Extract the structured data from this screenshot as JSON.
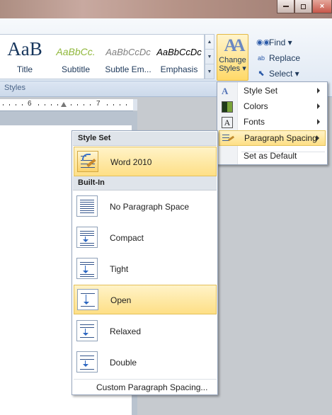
{
  "window": {
    "buttons": [
      "minimize-icon",
      "restore-icon",
      "close-icon"
    ]
  },
  "ribbon": {
    "style_gallery": [
      {
        "sample": "AaB",
        "label": "Title"
      },
      {
        "sample": "AaBbCc.",
        "label": "Subtitle"
      },
      {
        "sample": "AaBbCcDc",
        "label": "Subtle Em..."
      },
      {
        "sample": "AaBbCcDc",
        "label": "Emphasis"
      }
    ],
    "change_styles": {
      "line1": "Change",
      "line2": "Styles ▾"
    },
    "editing": {
      "find": "Find ▾",
      "replace": "Replace",
      "select": "Select ▾"
    },
    "group_label": "Styles"
  },
  "ruler": {
    "labels": [
      "6",
      "7"
    ]
  },
  "change_styles_menu": {
    "items": [
      {
        "label": "Style Set",
        "icon": "style-set-icon",
        "submenu": true
      },
      {
        "label": "Colors",
        "icon": "colors-icon",
        "submenu": true
      },
      {
        "label": "Fonts",
        "icon": "fonts-icon",
        "submenu": true
      },
      {
        "label": "Paragraph Spacing",
        "icon": "paragraph-spacing-icon",
        "submenu": true,
        "highlighted": true
      },
      {
        "label": "Set as Default",
        "icon": "",
        "submenu": false
      }
    ]
  },
  "paragraph_spacing_menu": {
    "section_style_set": "Style Set",
    "style_set_item": "Word 2010",
    "section_builtin": "Built-In",
    "builtin_items": [
      "No Paragraph Space",
      "Compact",
      "Tight",
      "Open",
      "Relaxed",
      "Double"
    ],
    "highlighted_item": "Open",
    "custom": "Custom Paragraph Spacing..."
  },
  "colors": {
    "highlight_top": "#fff2c6",
    "highlight_bottom": "#fedf84",
    "accent": "#1e395b"
  }
}
